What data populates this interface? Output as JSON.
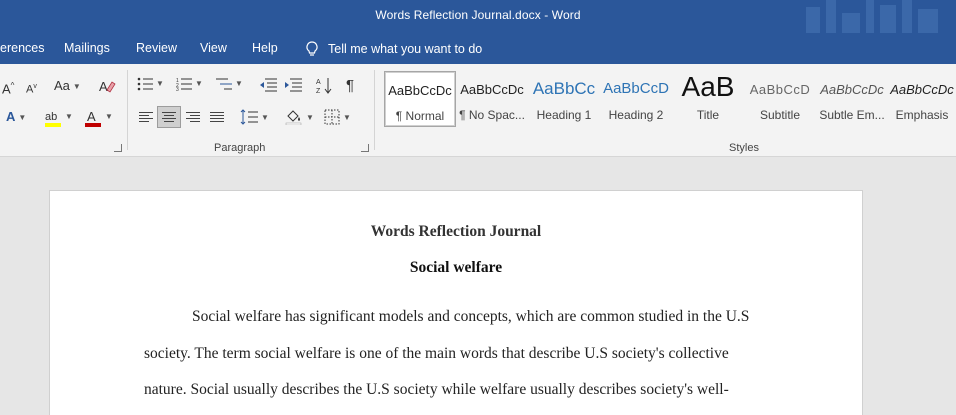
{
  "window": {
    "title": "Words Reflection Journal.docx  -  Word"
  },
  "tabs": [
    "erences",
    "Mailings",
    "Review",
    "View",
    "Help"
  ],
  "tell_me": "Tell me what you want to do",
  "ribbon": {
    "font_group": {
      "grow_font": "A",
      "shrink_font": "A",
      "change_case": "Aa",
      "text_effects": "A",
      "font_color_label": "A",
      "font_color": "#c00000",
      "highlight_color": "#ffff00"
    },
    "paragraph_group": {
      "label": "Paragraph",
      "pilcrow": "¶"
    },
    "styles_group": {
      "label": "Styles",
      "styles": [
        {
          "sample": "AaBbCcDc",
          "name": "¶ Normal",
          "selected": true
        },
        {
          "sample": "AaBbCcDc",
          "name": "¶ No Spac..."
        },
        {
          "sample": "AaBbCc",
          "name": "Heading 1"
        },
        {
          "sample": "AaBbCcD",
          "name": "Heading 2"
        },
        {
          "sample": "AaB",
          "name": "Title"
        },
        {
          "sample": "AaBbCcD",
          "name": "Subtitle"
        },
        {
          "sample": "AaBbCcDc",
          "name": "Subtle Em..."
        },
        {
          "sample": "AaBbCcDc",
          "name": "Emphasis"
        }
      ]
    }
  },
  "document": {
    "title": "Words Reflection Journal",
    "subtitle": "Social welfare",
    "lines": [
      "Social welfare has significant models and concepts, which are common studied in the U.S",
      "society. The term social welfare is one of the main words that describe U.S society's collective",
      "nature. Social usually describes the U.S society while welfare usually describes society's well-"
    ]
  },
  "colors": {
    "word_blue": "#2b579a",
    "heading_blue": "#2e74b5"
  }
}
